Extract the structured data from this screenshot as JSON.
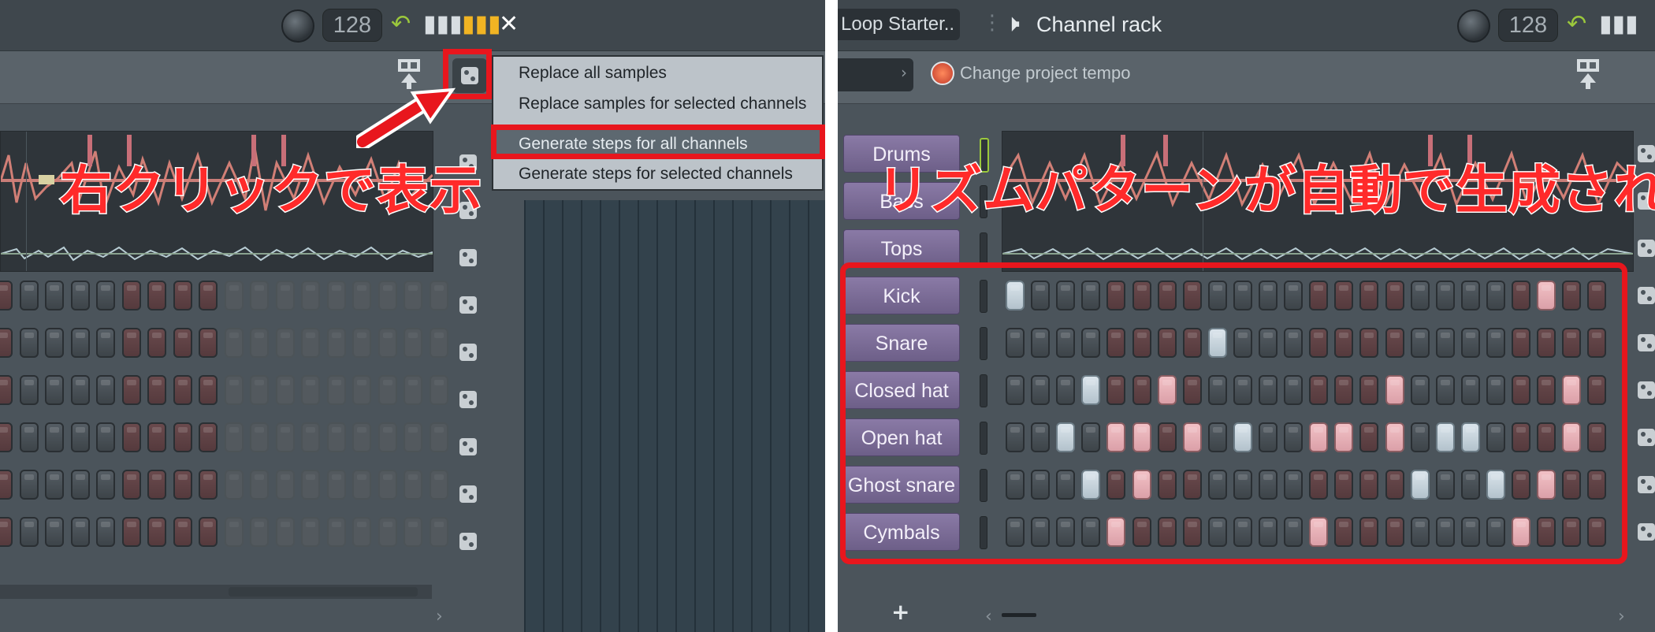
{
  "left": {
    "tempo": "128",
    "menu_items": [
      "Replace all samples",
      "Replace samples for selected channels",
      "Generate steps for all channels",
      "Generate steps for selected channels"
    ],
    "callout": "右クリックで表示",
    "scroll_arrow": "›",
    "grid_patterns": [
      "RDDDDRRRRDDDDDDDDD",
      "RDDDDRRRRDDDDDDDDD",
      "RDDDDRRRRDDDDDDDDD",
      "RDDDDRRRRDDDDDDDDD",
      "RDDDDRRRRDDDDDDDDD",
      "RDDDDRRRRDDDDDDDDD"
    ]
  },
  "right": {
    "pattern_name": "Loop Starter..",
    "title": "Channel rack",
    "tempo": "128",
    "change_tempo_label": "Change project tempo",
    "callout": "リズムパターンが自動で生成される",
    "add_label": "+",
    "scroll_left": "‹",
    "scroll_right": "›",
    "channels": [
      {
        "name": "Drums"
      },
      {
        "name": "Bass"
      },
      {
        "name": "Tops"
      },
      {
        "name": "Kick",
        "pattern": "bDDDRRRRDDDDRRRRDDDDRpRR"
      },
      {
        "name": "Snare",
        "pattern": "DDDDRRRRbDDDRRRRDDDDRRRR"
      },
      {
        "name": "Closed hat",
        "pattern": "DDDbRRpRDDDDRRRpDDDDRRpR"
      },
      {
        "name": "Open hat",
        "pattern": "DDbDppRpDbDDppRpDbbDRRpR"
      },
      {
        "name": "Ghost snare",
        "pattern": "DDDbRpRRDDDDRRRRbDDbRpRR"
      },
      {
        "name": "Cymbals",
        "pattern": "DDDDpRRRDDDDpRRRDDDDpRRR"
      }
    ]
  },
  "colors": {
    "highlight": "#e8161d",
    "channel_button": "#7b6b98",
    "step_pink": "#f2c1c6",
    "step_blue": "#dbe5ec",
    "tempo_accent": "#f1b423"
  }
}
